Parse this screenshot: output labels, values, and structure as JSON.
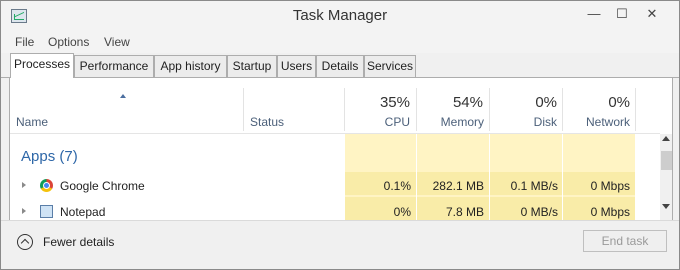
{
  "window": {
    "title": "Task Manager",
    "minimize_glyph": "—",
    "maximize_glyph": "☐",
    "close_glyph": "✕"
  },
  "menu": [
    "File",
    "Options",
    "View"
  ],
  "tabs": [
    "Processes",
    "Performance",
    "App history",
    "Startup",
    "Users",
    "Details",
    "Services"
  ],
  "active_tab": "Processes",
  "columns": {
    "name": "Name",
    "status": "Status",
    "cpu": {
      "pct": "35%",
      "label": "CPU"
    },
    "memory": {
      "pct": "54%",
      "label": "Memory"
    },
    "disk": {
      "pct": "0%",
      "label": "Disk"
    },
    "network": {
      "pct": "0%",
      "label": "Network"
    }
  },
  "group": {
    "label": "Apps (7)"
  },
  "rows": [
    {
      "name": "Google Chrome",
      "icon": "chrome-icon",
      "cpu": "0.1%",
      "memory": "282.1 MB",
      "disk": "0.1 MB/s",
      "network": "0 Mbps"
    },
    {
      "name": "Notepad",
      "icon": "notepad-icon",
      "cpu": "0%",
      "memory": "7.8 MB",
      "disk": "0 MB/s",
      "network": "0 Mbps"
    }
  ],
  "footer": {
    "fewer_details": "Fewer details",
    "end_task": "End task"
  },
  "colors": {
    "heat_light": "#fff4c4",
    "heat_medium": "#f9eca8",
    "accent_text": "#2e67a8"
  }
}
